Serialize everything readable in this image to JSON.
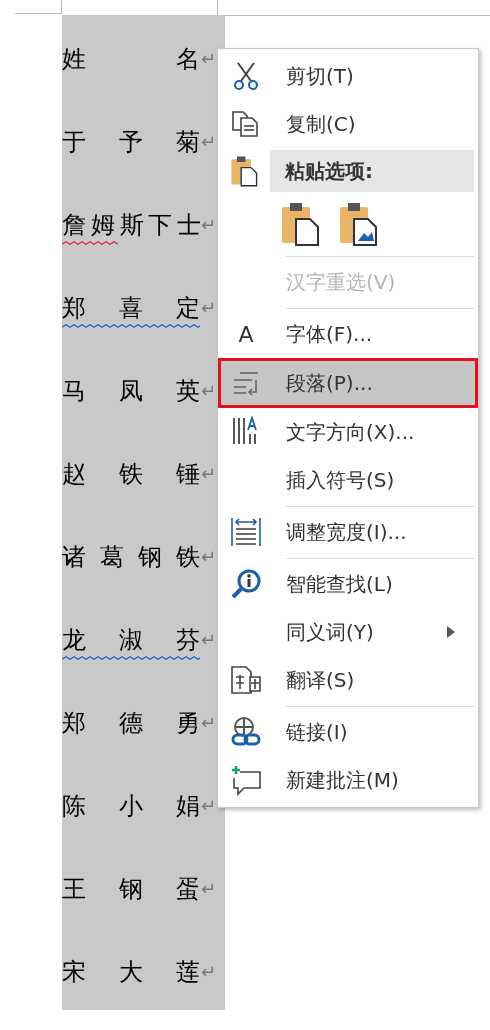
{
  "names": [
    {
      "text": "姓名",
      "mark": "↵",
      "spelling_error": false,
      "grammar_error": false
    },
    {
      "text": "于予菊",
      "mark": "↵",
      "spelling_error": false,
      "grammar_error": false
    },
    {
      "text": "詹姆斯下士",
      "mark": "↵",
      "spelling_error": true,
      "grammar_error": false
    },
    {
      "text": "郑喜定",
      "mark": "↵",
      "spelling_error": false,
      "grammar_error": true
    },
    {
      "text": "马凤英",
      "mark": "↵",
      "spelling_error": false,
      "grammar_error": false
    },
    {
      "text": "赵铁锤",
      "mark": "↵",
      "spelling_error": false,
      "grammar_error": false
    },
    {
      "text": "诸葛钢铁",
      "mark": "↵",
      "spelling_error": false,
      "grammar_error": false
    },
    {
      "text": "龙淑芬",
      "mark": "↵",
      "spelling_error": false,
      "grammar_error": true
    },
    {
      "text": "郑德勇",
      "mark": "↵",
      "spelling_error": false,
      "grammar_error": false
    },
    {
      "text": "陈小娟",
      "mark": "↵",
      "spelling_error": false,
      "grammar_error": false
    },
    {
      "text": "王钢蛋",
      "mark": "↵",
      "spelling_error": false,
      "grammar_error": false
    },
    {
      "text": "宋大莲",
      "mark": "↵",
      "spelling_error": false,
      "grammar_error": false
    }
  ],
  "context_menu": {
    "items": [
      {
        "kind": "item",
        "label": "剪切(T)",
        "disabled": false,
        "selected": false,
        "submenu": false
      },
      {
        "kind": "item",
        "label": "复制(C)",
        "disabled": false,
        "selected": false,
        "submenu": false
      },
      {
        "kind": "header",
        "label": "粘贴选项:"
      },
      {
        "kind": "paste_options"
      },
      {
        "kind": "separator"
      },
      {
        "kind": "item",
        "label": "汉字重选(V)",
        "disabled": true,
        "selected": false,
        "submenu": false
      },
      {
        "kind": "separator"
      },
      {
        "kind": "item",
        "label": "字体(F)...",
        "disabled": false,
        "selected": false,
        "submenu": false,
        "icon_text": "A"
      },
      {
        "kind": "item",
        "label": "段落(P)...",
        "disabled": false,
        "selected": true,
        "submenu": false
      },
      {
        "kind": "item",
        "label": "文字方向(X)...",
        "disabled": false,
        "selected": false,
        "submenu": false
      },
      {
        "kind": "item",
        "label": "插入符号(S)",
        "disabled": false,
        "selected": false,
        "submenu": false
      },
      {
        "kind": "separator"
      },
      {
        "kind": "item",
        "label": "调整宽度(I)...",
        "disabled": false,
        "selected": false,
        "submenu": false
      },
      {
        "kind": "separator"
      },
      {
        "kind": "item",
        "label": "智能查找(L)",
        "disabled": false,
        "selected": false,
        "submenu": false
      },
      {
        "kind": "item",
        "label": "同义词(Y)",
        "disabled": false,
        "selected": false,
        "submenu": true
      },
      {
        "kind": "item",
        "label": "翻译(S)",
        "disabled": false,
        "selected": false,
        "submenu": false
      },
      {
        "kind": "separator"
      },
      {
        "kind": "item",
        "label": "链接(I)",
        "disabled": false,
        "selected": false,
        "submenu": false
      },
      {
        "kind": "item",
        "label": "新建批注(M)",
        "disabled": false,
        "selected": false,
        "submenu": false
      }
    ]
  }
}
